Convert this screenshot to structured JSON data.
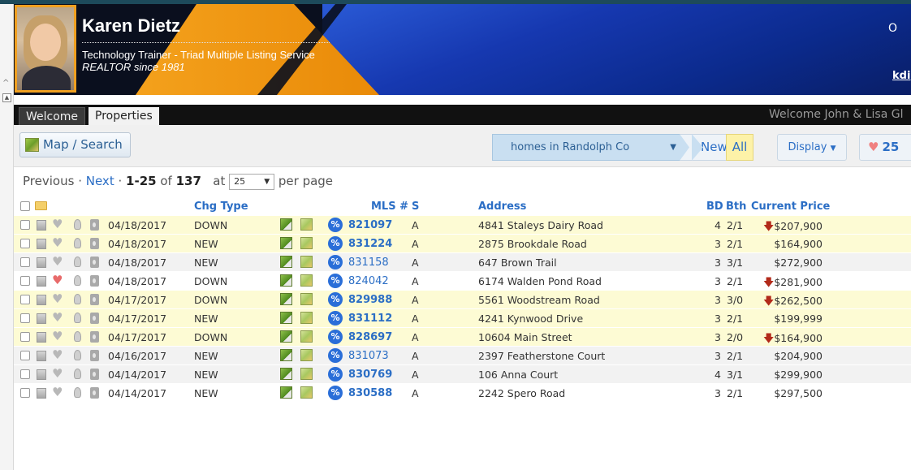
{
  "header": {
    "agent_name": "Karen Dietz",
    "agent_title": "Technology Trainer - Triad Multiple Listing Service",
    "agent_since": "REALTOR since 1981",
    "right_text": "O",
    "right_link": "kdi"
  },
  "nav": {
    "tabs": [
      {
        "label": "Welcome"
      },
      {
        "label": "Properties"
      }
    ],
    "welcome_message": "Welcome John & Lisa Gl"
  },
  "toolbar": {
    "map_search_label": "Map / Search",
    "saved_search_value": "homes in Randolph Co",
    "crumb_new": "New",
    "crumb_all": "All",
    "display_label": "Display",
    "favorites_count": "25"
  },
  "pager": {
    "previous": "Previous",
    "sep": "·",
    "next": "Next",
    "range": "1-25",
    "of": "of",
    "total": "137",
    "at": "at",
    "per_page_value": "25",
    "per_page_label": "per page"
  },
  "table": {
    "headers": {
      "chg_type": "Chg Type",
      "mls": "MLS #",
      "status": "S",
      "address": "Address",
      "bd": "BD",
      "bth": "Bth",
      "price": "Current Price"
    },
    "rows": [
      {
        "date": "04/18/2017",
        "chg": "DOWN",
        "mls": "821097",
        "mls_bold": true,
        "status": "A",
        "address": "4841 Staleys Dairy Road",
        "bd": "4",
        "bth": "2/1",
        "price": "$207,900",
        "price_down": true,
        "favorite": false,
        "bg": "yellow"
      },
      {
        "date": "04/18/2017",
        "chg": "NEW",
        "mls": "831224",
        "mls_bold": true,
        "status": "A",
        "address": "2875 Brookdale Road",
        "bd": "3",
        "bth": "2/1",
        "price": "$164,900",
        "price_down": false,
        "favorite": false,
        "bg": "yellow"
      },
      {
        "date": "04/18/2017",
        "chg": "NEW",
        "mls": "831158",
        "mls_bold": false,
        "status": "A",
        "address": "647 Brown Trail",
        "bd": "3",
        "bth": "3/1",
        "price": "$272,900",
        "price_down": false,
        "favorite": false,
        "bg": "gray"
      },
      {
        "date": "04/18/2017",
        "chg": "DOWN",
        "mls": "824042",
        "mls_bold": false,
        "status": "A",
        "address": "6174 Walden Pond Road",
        "bd": "3",
        "bth": "2/1",
        "price": "$281,900",
        "price_down": true,
        "favorite": true,
        "bg": "white"
      },
      {
        "date": "04/17/2017",
        "chg": "DOWN",
        "mls": "829988",
        "mls_bold": true,
        "status": "A",
        "address": "5561 Woodstream Road",
        "bd": "3",
        "bth": "3/0",
        "price": "$262,500",
        "price_down": true,
        "favorite": false,
        "bg": "yellow"
      },
      {
        "date": "04/17/2017",
        "chg": "NEW",
        "mls": "831112",
        "mls_bold": true,
        "status": "A",
        "address": "4241 Kynwood Drive",
        "bd": "3",
        "bth": "2/1",
        "price": "$199,999",
        "price_down": false,
        "favorite": false,
        "bg": "yellow"
      },
      {
        "date": "04/17/2017",
        "chg": "DOWN",
        "mls": "828697",
        "mls_bold": true,
        "status": "A",
        "address": "10604 Main Street",
        "bd": "3",
        "bth": "2/0",
        "price": "$164,900",
        "price_down": true,
        "favorite": false,
        "bg": "yellow"
      },
      {
        "date": "04/16/2017",
        "chg": "NEW",
        "mls": "831073",
        "mls_bold": false,
        "status": "A",
        "address": "2397 Featherstone Court",
        "bd": "3",
        "bth": "2/1",
        "price": "$204,900",
        "price_down": false,
        "favorite": false,
        "bg": "gray"
      },
      {
        "date": "04/14/2017",
        "chg": "NEW",
        "mls": "830769",
        "mls_bold": true,
        "status": "A",
        "address": "106 Anna Court",
        "bd": "4",
        "bth": "3/1",
        "price": "$299,900",
        "price_down": false,
        "favorite": false,
        "bg": "gray"
      },
      {
        "date": "04/14/2017",
        "chg": "NEW",
        "mls": "830588",
        "mls_bold": true,
        "status": "A",
        "address": "2242 Spero Road",
        "bd": "3",
        "bth": "2/1",
        "price": "$297,500",
        "price_down": false,
        "favorite": false,
        "bg": "white"
      }
    ]
  }
}
